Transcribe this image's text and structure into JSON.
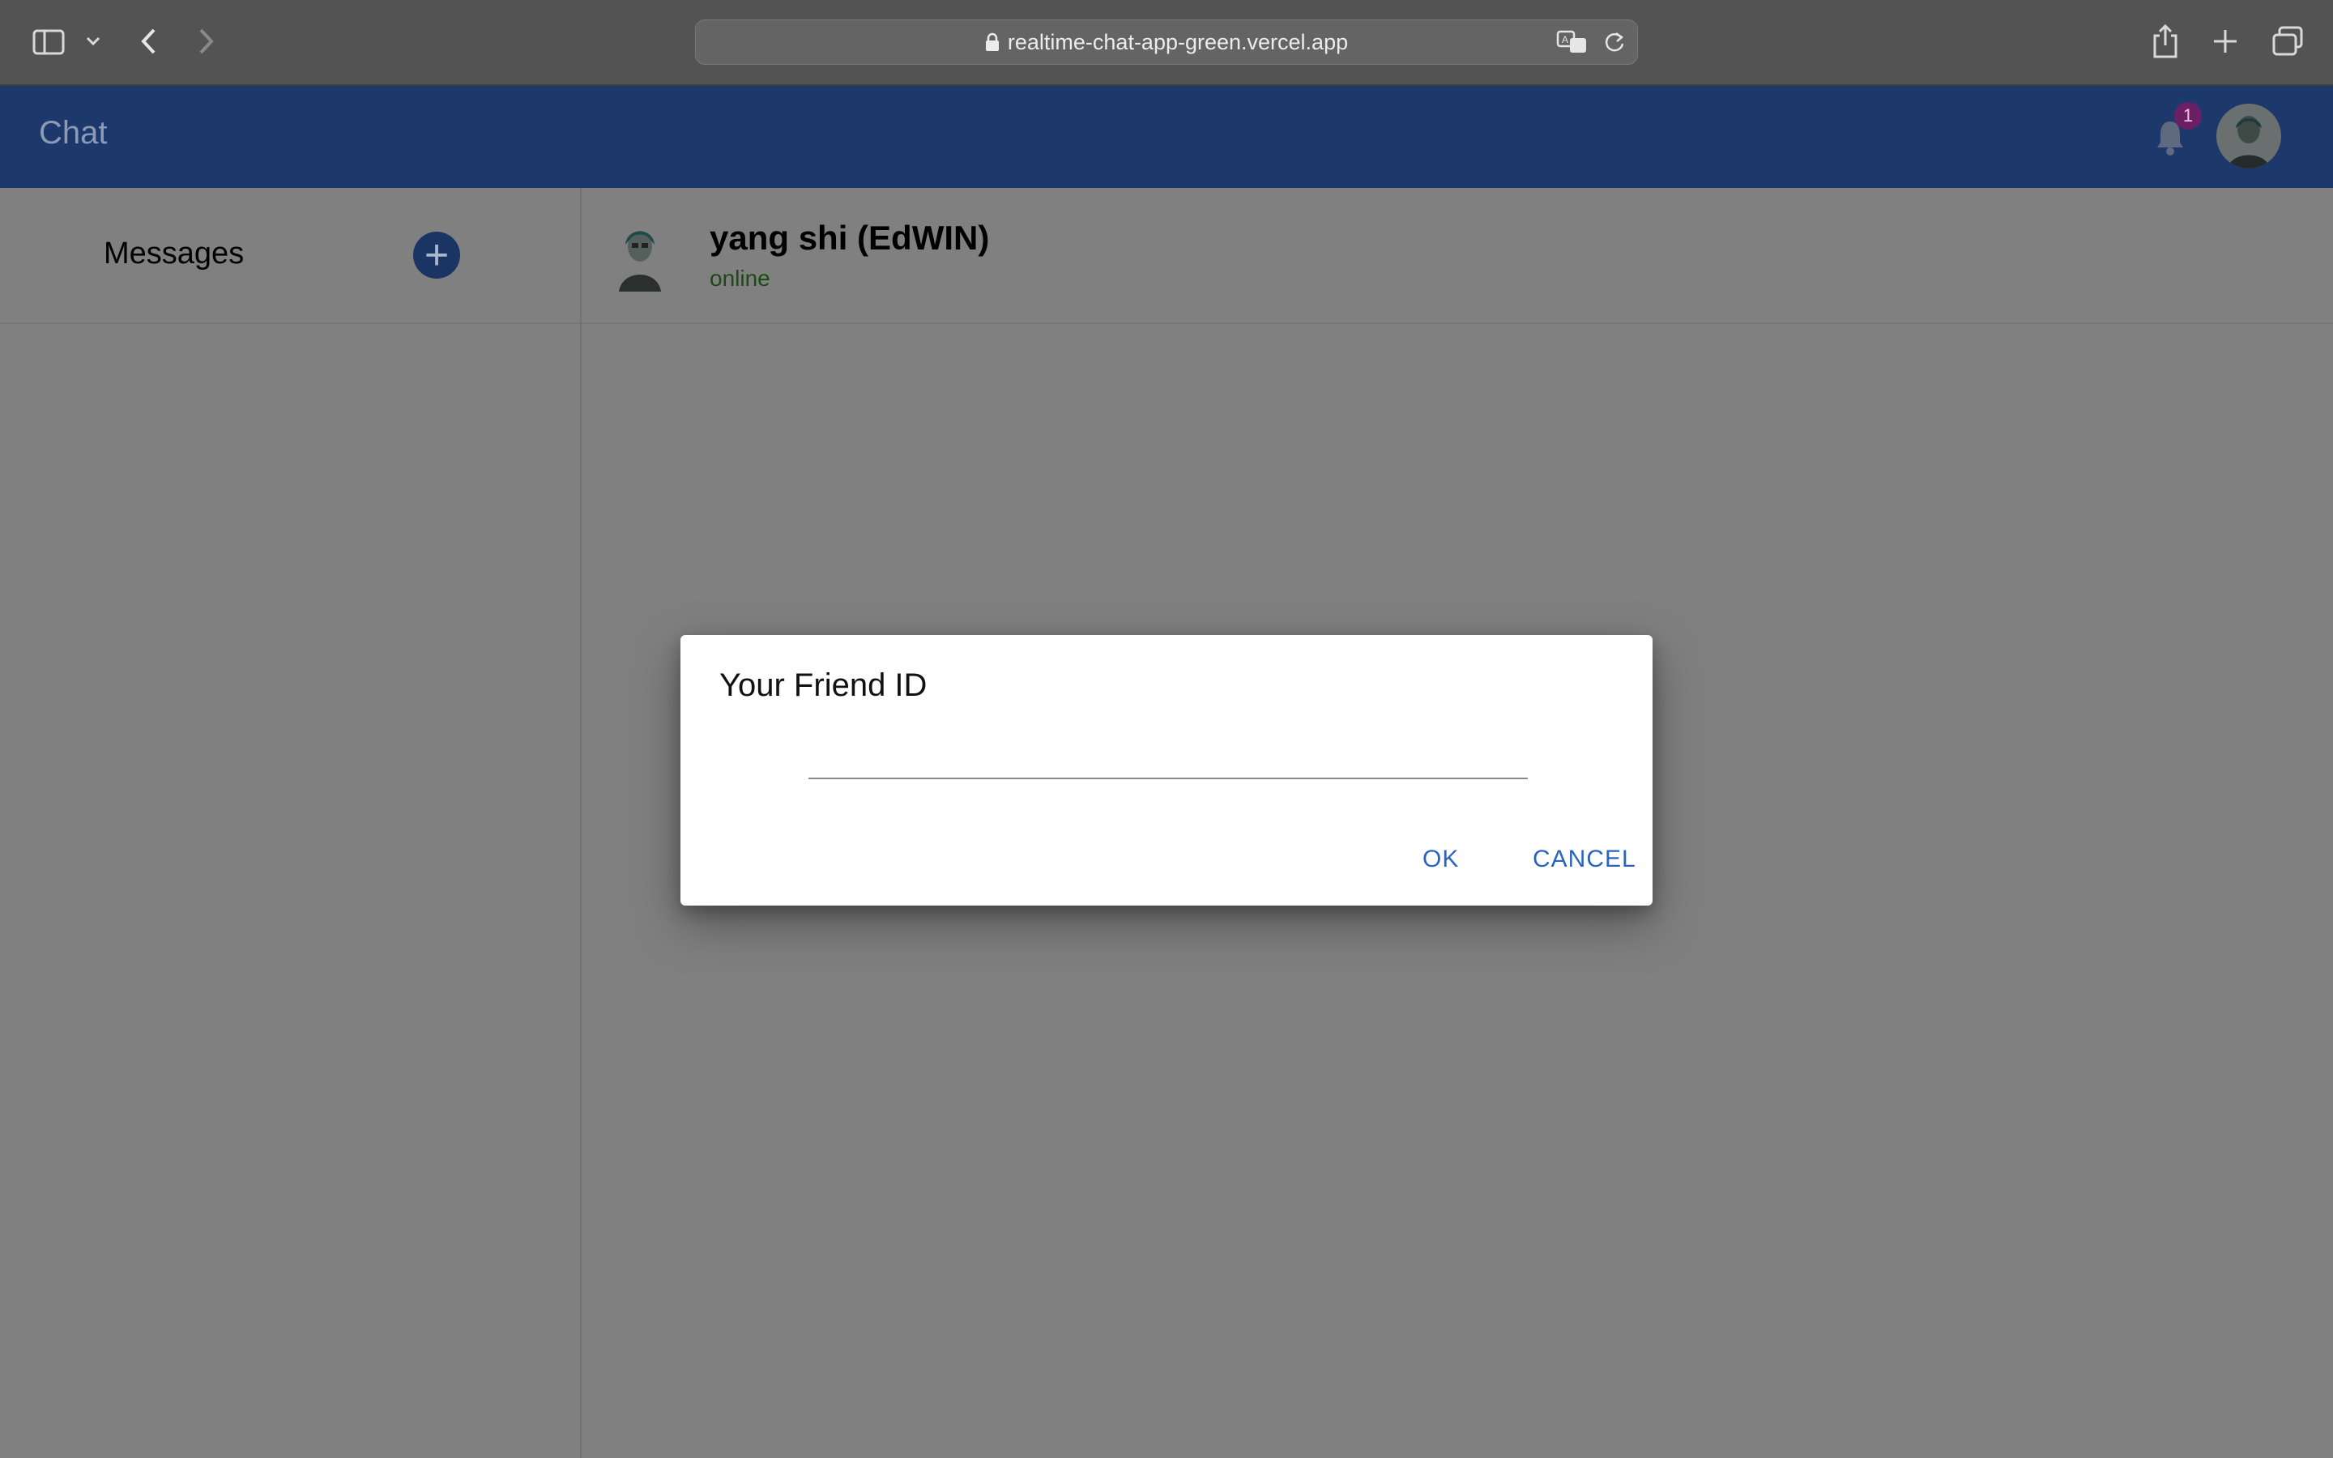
{
  "browser": {
    "url": "realtime-chat-app-green.vercel.app"
  },
  "app": {
    "title": "Chat",
    "notification_count": "1"
  },
  "sidebar": {
    "heading": "Messages",
    "add_label": "+"
  },
  "conversation": {
    "contact_name": "yang shi (EdWIN)",
    "status": "online"
  },
  "dialog": {
    "title": "Your Friend ID",
    "input_value": "",
    "ok_label": "OK",
    "cancel_label": "CANCEL"
  },
  "colors": {
    "header": "#1d386b",
    "overlay": "#808080",
    "accent": "#2a63c0",
    "status_online": "#1c4a14",
    "badge": "#6d1f64"
  },
  "icons": [
    "sidebar-toggle-icon",
    "chevron-down-icon",
    "back-icon",
    "forward-icon",
    "lock-icon",
    "translate-icon",
    "reload-icon",
    "share-icon",
    "new-tab-icon",
    "tabs-overview-icon",
    "bell-icon",
    "add-icon"
  ]
}
